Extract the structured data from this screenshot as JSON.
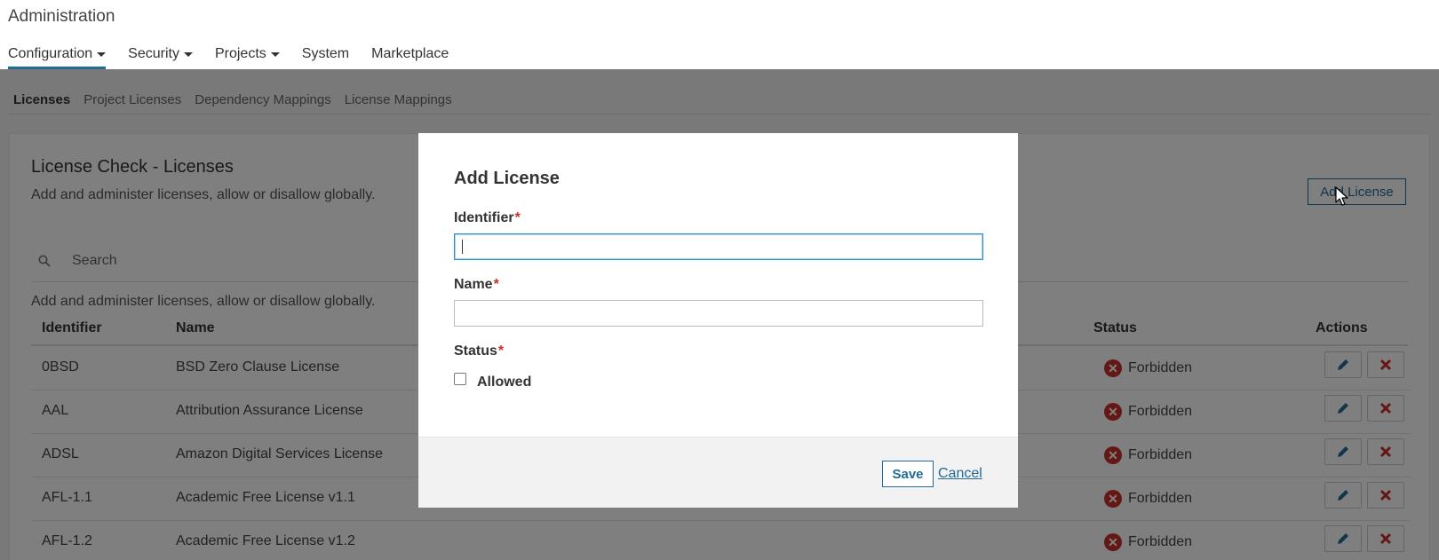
{
  "app": {
    "title": "Administration"
  },
  "main_nav": [
    {
      "label": "Configuration",
      "has_dropdown": true,
      "active": true
    },
    {
      "label": "Security",
      "has_dropdown": true,
      "active": false
    },
    {
      "label": "Projects",
      "has_dropdown": true,
      "active": false
    },
    {
      "label": "System",
      "has_dropdown": false,
      "active": false
    },
    {
      "label": "Marketplace",
      "has_dropdown": false,
      "active": false
    }
  ],
  "sub_nav": [
    {
      "label": "Licenses",
      "active": true
    },
    {
      "label": "Project Licenses",
      "active": false
    },
    {
      "label": "Dependency Mappings",
      "active": false
    },
    {
      "label": "License Mappings",
      "active": false
    }
  ],
  "page": {
    "title": "License Check - Licenses",
    "description": "Add and administer licenses, allow or disallow globally.",
    "add_button": "Add License",
    "search_placeholder": "Search",
    "table_description": "Add and administer licenses, allow or disallow globally.",
    "columns": {
      "identifier": "Identifier",
      "name": "Name",
      "status": "Status",
      "actions": "Actions"
    },
    "rows": [
      {
        "identifier": "0BSD",
        "name": "BSD Zero Clause License",
        "status": "Forbidden"
      },
      {
        "identifier": "AAL",
        "name": "Attribution Assurance License",
        "status": "Forbidden"
      },
      {
        "identifier": "ADSL",
        "name": "Amazon Digital Services License",
        "status": "Forbidden"
      },
      {
        "identifier": "AFL-1.1",
        "name": "Academic Free License v1.1",
        "status": "Forbidden"
      },
      {
        "identifier": "AFL-1.2",
        "name": "Academic Free License v1.2",
        "status": "Forbidden"
      }
    ],
    "status_icon": "x-circle-icon",
    "edit_icon": "pencil-icon",
    "delete_icon": "x-icon"
  },
  "modal": {
    "title": "Add License",
    "identifier_label": "Identifier",
    "identifier_value": "",
    "name_label": "Name",
    "name_value": "",
    "status_label": "Status",
    "required_mark": "*",
    "allowed_label": "Allowed",
    "allowed_checked": false,
    "save_label": "Save",
    "cancel_label": "Cancel"
  },
  "colors": {
    "accent": "#236a97",
    "forbidden": "#c9302c",
    "overlay": "rgba(0,0,0,0.5)"
  }
}
